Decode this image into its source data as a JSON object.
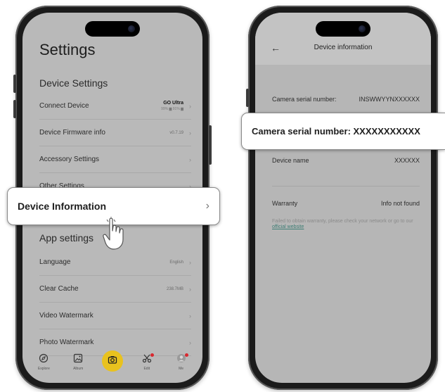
{
  "left_phone": {
    "title": "Settings",
    "device_settings_heading": "Device Settings",
    "device_rows": [
      {
        "label": "Connect Device",
        "device": "GO Ultra",
        "battery": "99% ▆ 91% ▆"
      },
      {
        "label": "Device Firmware info",
        "value": "v0.7.19"
      },
      {
        "label": "Accessory Settings"
      },
      {
        "label": "Other Settings"
      }
    ],
    "app_settings_heading": "App settings",
    "app_rows": [
      {
        "label": "Language",
        "value": "English"
      },
      {
        "label": "Clear Cache",
        "value": "238.7MB"
      },
      {
        "label": "Video Watermark"
      },
      {
        "label": "Photo Watermark"
      }
    ],
    "tabbar": [
      {
        "label": "Explore",
        "icon": "compass-icon"
      },
      {
        "label": "Album",
        "icon": "image-icon"
      },
      {
        "label": "",
        "icon": "camera-icon"
      },
      {
        "label": "Edit",
        "icon": "scissors-icon"
      },
      {
        "label": "Me",
        "icon": "user-icon"
      }
    ]
  },
  "callouts": {
    "device_information": "Device Information",
    "camera_serial": "Camera serial number: XXXXXXXXXXX"
  },
  "right_phone": {
    "header_title": "Device information",
    "serial_label": "Camera serial number:",
    "serial_value": "INSWWYYNXXXXXX",
    "device_name_label": "Device name",
    "device_name_value": "XXXXXX",
    "warranty_label": "Warranty",
    "warranty_value": "Info not found",
    "warranty_note": "Failed to obtain warranty, please check your network or go to our",
    "warranty_link": "official website"
  },
  "colors": {
    "camera_button": "#e9c21e",
    "notification_dot": "#d8282f",
    "link": "#3d7d74"
  }
}
